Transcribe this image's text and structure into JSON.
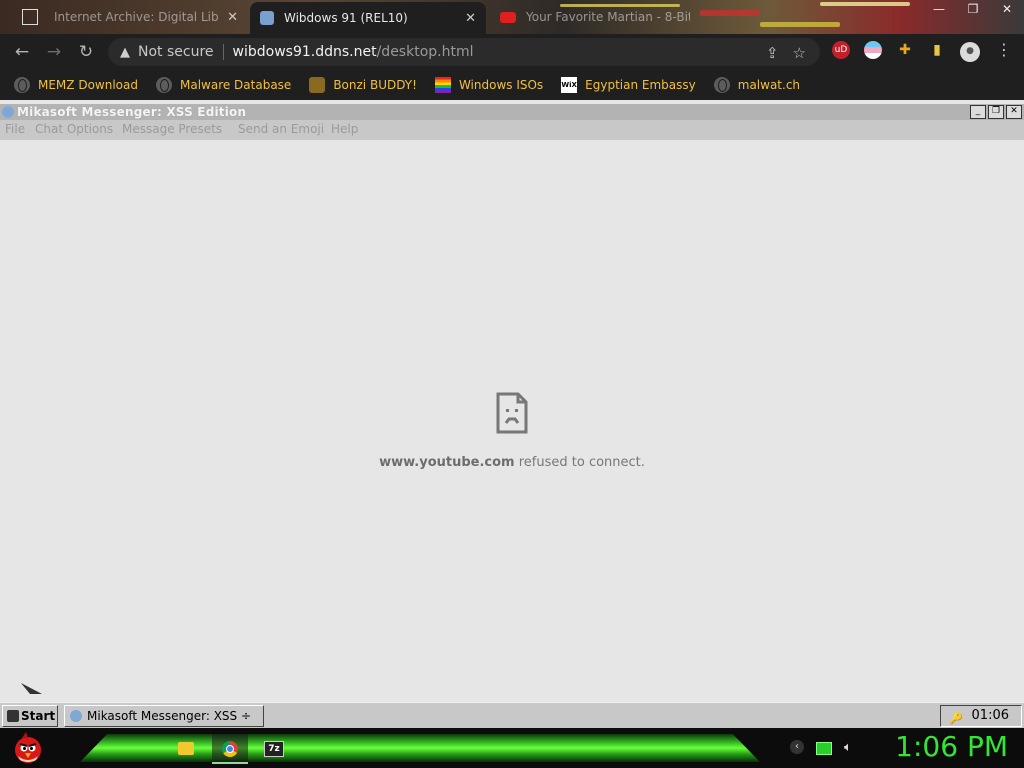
{
  "browser": {
    "tabs": [
      {
        "title": "Internet Archive: Digital Library",
        "active": false
      },
      {
        "title": "Wibdows 91 (REL10)",
        "active": true
      },
      {
        "title": "Your Favorite Martian - 8-Bit W",
        "active": false
      }
    ],
    "window_controls": {
      "minimize": "—",
      "restore": "❐",
      "close": "✕"
    },
    "nav": {
      "back": "←",
      "forward": "→",
      "reload": "↻"
    },
    "omnibox": {
      "security_label": "Not secure",
      "host": "wibdows91.ddns.net",
      "path": "/desktop.html"
    },
    "extensions": [
      {
        "name": "ublock",
        "label": "uD",
        "color": "#c0202a"
      },
      {
        "name": "flag",
        "label": "",
        "color": "#f0a8c0"
      },
      {
        "name": "puzzle",
        "label": "✚",
        "color": "#e8a820"
      },
      {
        "name": "sidepanel",
        "label": "▮",
        "color": "#e8c840"
      },
      {
        "name": "profile",
        "label": "●",
        "color": "#dcdcdc"
      }
    ],
    "bookmarks": [
      {
        "label": "MEMZ Download",
        "icon": "globe-icon"
      },
      {
        "label": "Malware Database",
        "icon": "globe-icon"
      },
      {
        "label": "Bonzi BUDDY!",
        "icon": "bonzi-icon"
      },
      {
        "label": "Windows ISOs",
        "icon": "rainbow-flag-icon"
      },
      {
        "label": "Egyptian Embassy",
        "icon": "wix-icon"
      },
      {
        "label": "malwat.ch",
        "icon": "globe-icon"
      }
    ]
  },
  "messenger": {
    "title": "Mikasoft Messenger: XSS Edition",
    "title_buttons": [
      "_",
      "❐",
      "✕"
    ],
    "menu": [
      "File",
      "Chat Options",
      "Message Presets",
      "Send an Emoji",
      "Help"
    ]
  },
  "error": {
    "host": "www.youtube.com",
    "message": "refused to connect."
  },
  "wibdows_taskbar": {
    "start_label": "Start",
    "task_label": "Mikasoft Messenger: XSS ÷",
    "clock": "01:06"
  },
  "windows_taskbar": {
    "pinned": [
      "folder-icon",
      "chrome-icon",
      "7zip-icon"
    ],
    "pinned_labels": [
      "",
      "",
      "7z"
    ],
    "tray": [
      "chevron-icon",
      "monitor-icon",
      "volume-icon"
    ],
    "clock": "1:06 PM"
  },
  "colors": {
    "chrome_dark": "#1f1f1f",
    "bookmark_text": "#f0c040",
    "page_bg": "#e6e6e6",
    "clock_green": "#34e634"
  }
}
